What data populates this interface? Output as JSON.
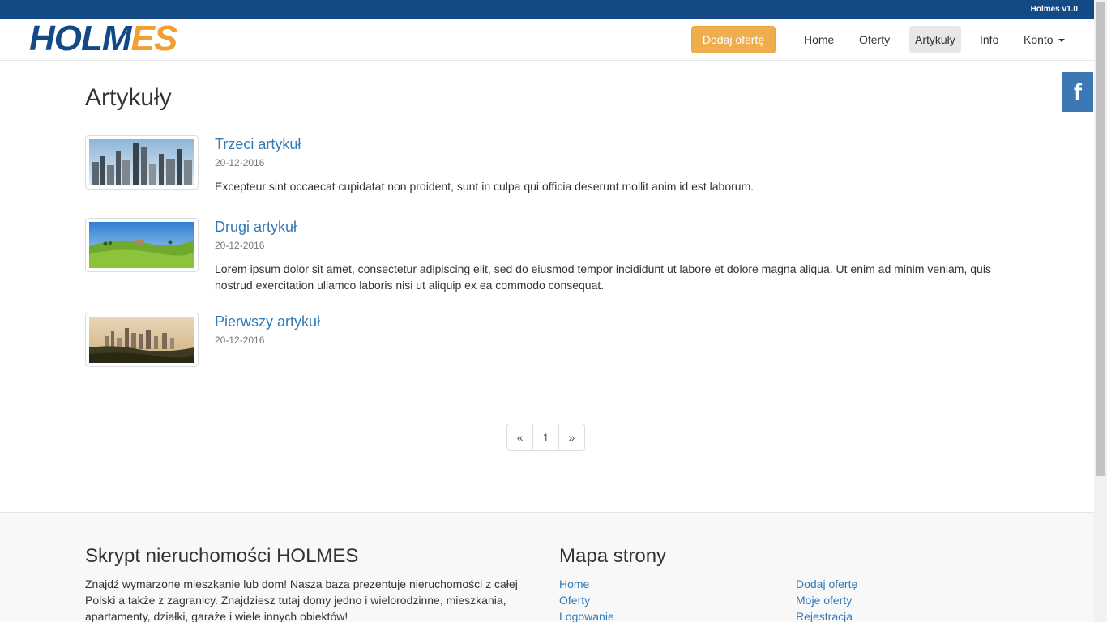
{
  "topbar": {
    "version": "Holmes v1.0"
  },
  "brand": {
    "logo_part1": "HOLM",
    "logo_part2": "ES",
    "colors": {
      "primary": "#134a86",
      "accent": "#f0a030"
    }
  },
  "nav": {
    "add_offer": "Dodaj ofertę",
    "items": [
      "Home",
      "Oferty",
      "Artykuły",
      "Info",
      "Konto"
    ],
    "active": "Artykuły"
  },
  "social": {
    "facebook_label": "f"
  },
  "page": {
    "title": "Artykuły"
  },
  "articles": [
    {
      "title": "Trzeci artykuł",
      "date": "20-12-2016",
      "text": "Excepteur sint occaecat cupidatat non proident, sunt in culpa qui officia deserunt mollit anim id est laborum.",
      "image": "city-skyline-daylight"
    },
    {
      "title": "Drugi artykuł",
      "date": "20-12-2016",
      "text": "Lorem ipsum dolor sit amet, consectetur adipiscing elit, sed do eiusmod tempor incididunt ut labore et dolore magna aliqua. Ut enim ad minim veniam, quis nostrud exercitation ullamco laboris nisi ut aliquip ex ea commodo consequat.",
      "image": "green-meadow"
    },
    {
      "title": "Pierwszy artykuł",
      "date": "20-12-2016",
      "text": "",
      "image": "city-skyline-sunset"
    }
  ],
  "pagination": {
    "prev": "«",
    "current": "1",
    "next": "»"
  },
  "footer": {
    "about_title": "Skrypt nieruchomości HOLMES",
    "about_text": "Znajdź wymarzone mieszkanie lub dom! Nasza baza prezentuje nieruchomości z całej Polski a także z zagranicy. Znajdziesz tutaj domy jedno i wielorodzinne, mieszkania, apartamenty, działki, garaże i wiele innych obiektów!",
    "sitemap_title": "Mapa strony",
    "links_col1": [
      "Home",
      "Oferty",
      "Logowanie"
    ],
    "links_col2": [
      "Dodaj ofertę",
      "Moje oferty",
      "Rejestracja"
    ]
  }
}
